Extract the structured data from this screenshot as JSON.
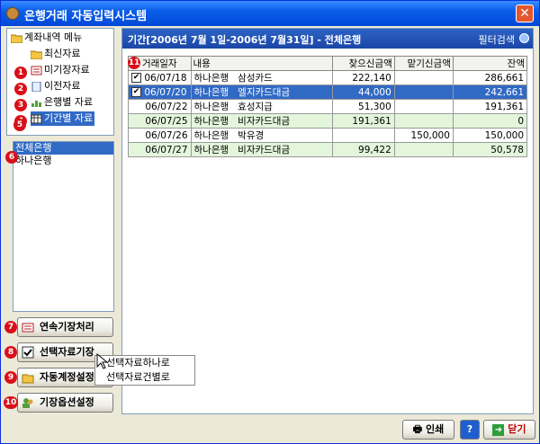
{
  "window": {
    "title": "은행거래 자동입력시스템"
  },
  "sidebar": {
    "menu_title": "계좌내역 메뉴",
    "items": [
      {
        "label": "최신자료",
        "badge": "1"
      },
      {
        "label": "미기장자료",
        "badge": "2"
      },
      {
        "label": "이전자료",
        "badge": "3"
      },
      {
        "label": "은행별 자료",
        "badge": "4"
      },
      {
        "label": "기간별 자료",
        "badge": "5"
      }
    ],
    "list_badge": "6",
    "list": [
      "전체은행",
      "하나은행"
    ],
    "buttons": [
      {
        "label": "연속기장처리",
        "badge": "7"
      },
      {
        "label": "선택자료기장",
        "badge": "8"
      },
      {
        "label": "자동계정설정",
        "badge": "9"
      },
      {
        "label": "기장옵션설정",
        "badge": "10"
      }
    ]
  },
  "context_menu": {
    "items": [
      "선택자료하나로",
      "선택자료건별로"
    ]
  },
  "main": {
    "period": "기간[2006년 7월 1일-2006년 7월31일] - 전체은행",
    "filter_label": "필터검색",
    "grid_badge": "11",
    "columns": [
      "거래일자",
      "내용",
      "찾으신금액",
      "맡기신금액",
      "잔액"
    ],
    "rows": [
      {
        "checked": true,
        "date": "06/07/18",
        "bank": "하나은행",
        "desc": "삼성카드",
        "out": "222,140",
        "in": "",
        "balance": "286,661"
      },
      {
        "checked": true,
        "date": "06/07/20",
        "bank": "하나은행",
        "desc": "엘지카드대금",
        "out": "44,000",
        "in": "",
        "balance": "242,661"
      },
      {
        "checked": false,
        "date": "06/07/22",
        "bank": "하나은행",
        "desc": "효성지급",
        "out": "51,300",
        "in": "",
        "balance": "191,361"
      },
      {
        "checked": false,
        "date": "06/07/25",
        "bank": "하나은행",
        "desc": "비자카드대금",
        "out": "191,361",
        "in": "",
        "balance": "0"
      },
      {
        "checked": false,
        "date": "06/07/26",
        "bank": "하나은행",
        "desc": "박유경",
        "out": "",
        "in": "150,000",
        "balance": "150,000"
      },
      {
        "checked": false,
        "date": "06/07/27",
        "bank": "하나은행",
        "desc": "비자카드대금",
        "out": "99,422",
        "in": "",
        "balance": "50,578"
      }
    ]
  },
  "footer": {
    "print_label": "인쇄",
    "help_label": "?",
    "close_label": "닫기"
  },
  "colors": {
    "title_bar": "#0A5EE8",
    "selection": "#316AC5",
    "green_row": "#E3F6DC",
    "badge": "#D8101A"
  }
}
